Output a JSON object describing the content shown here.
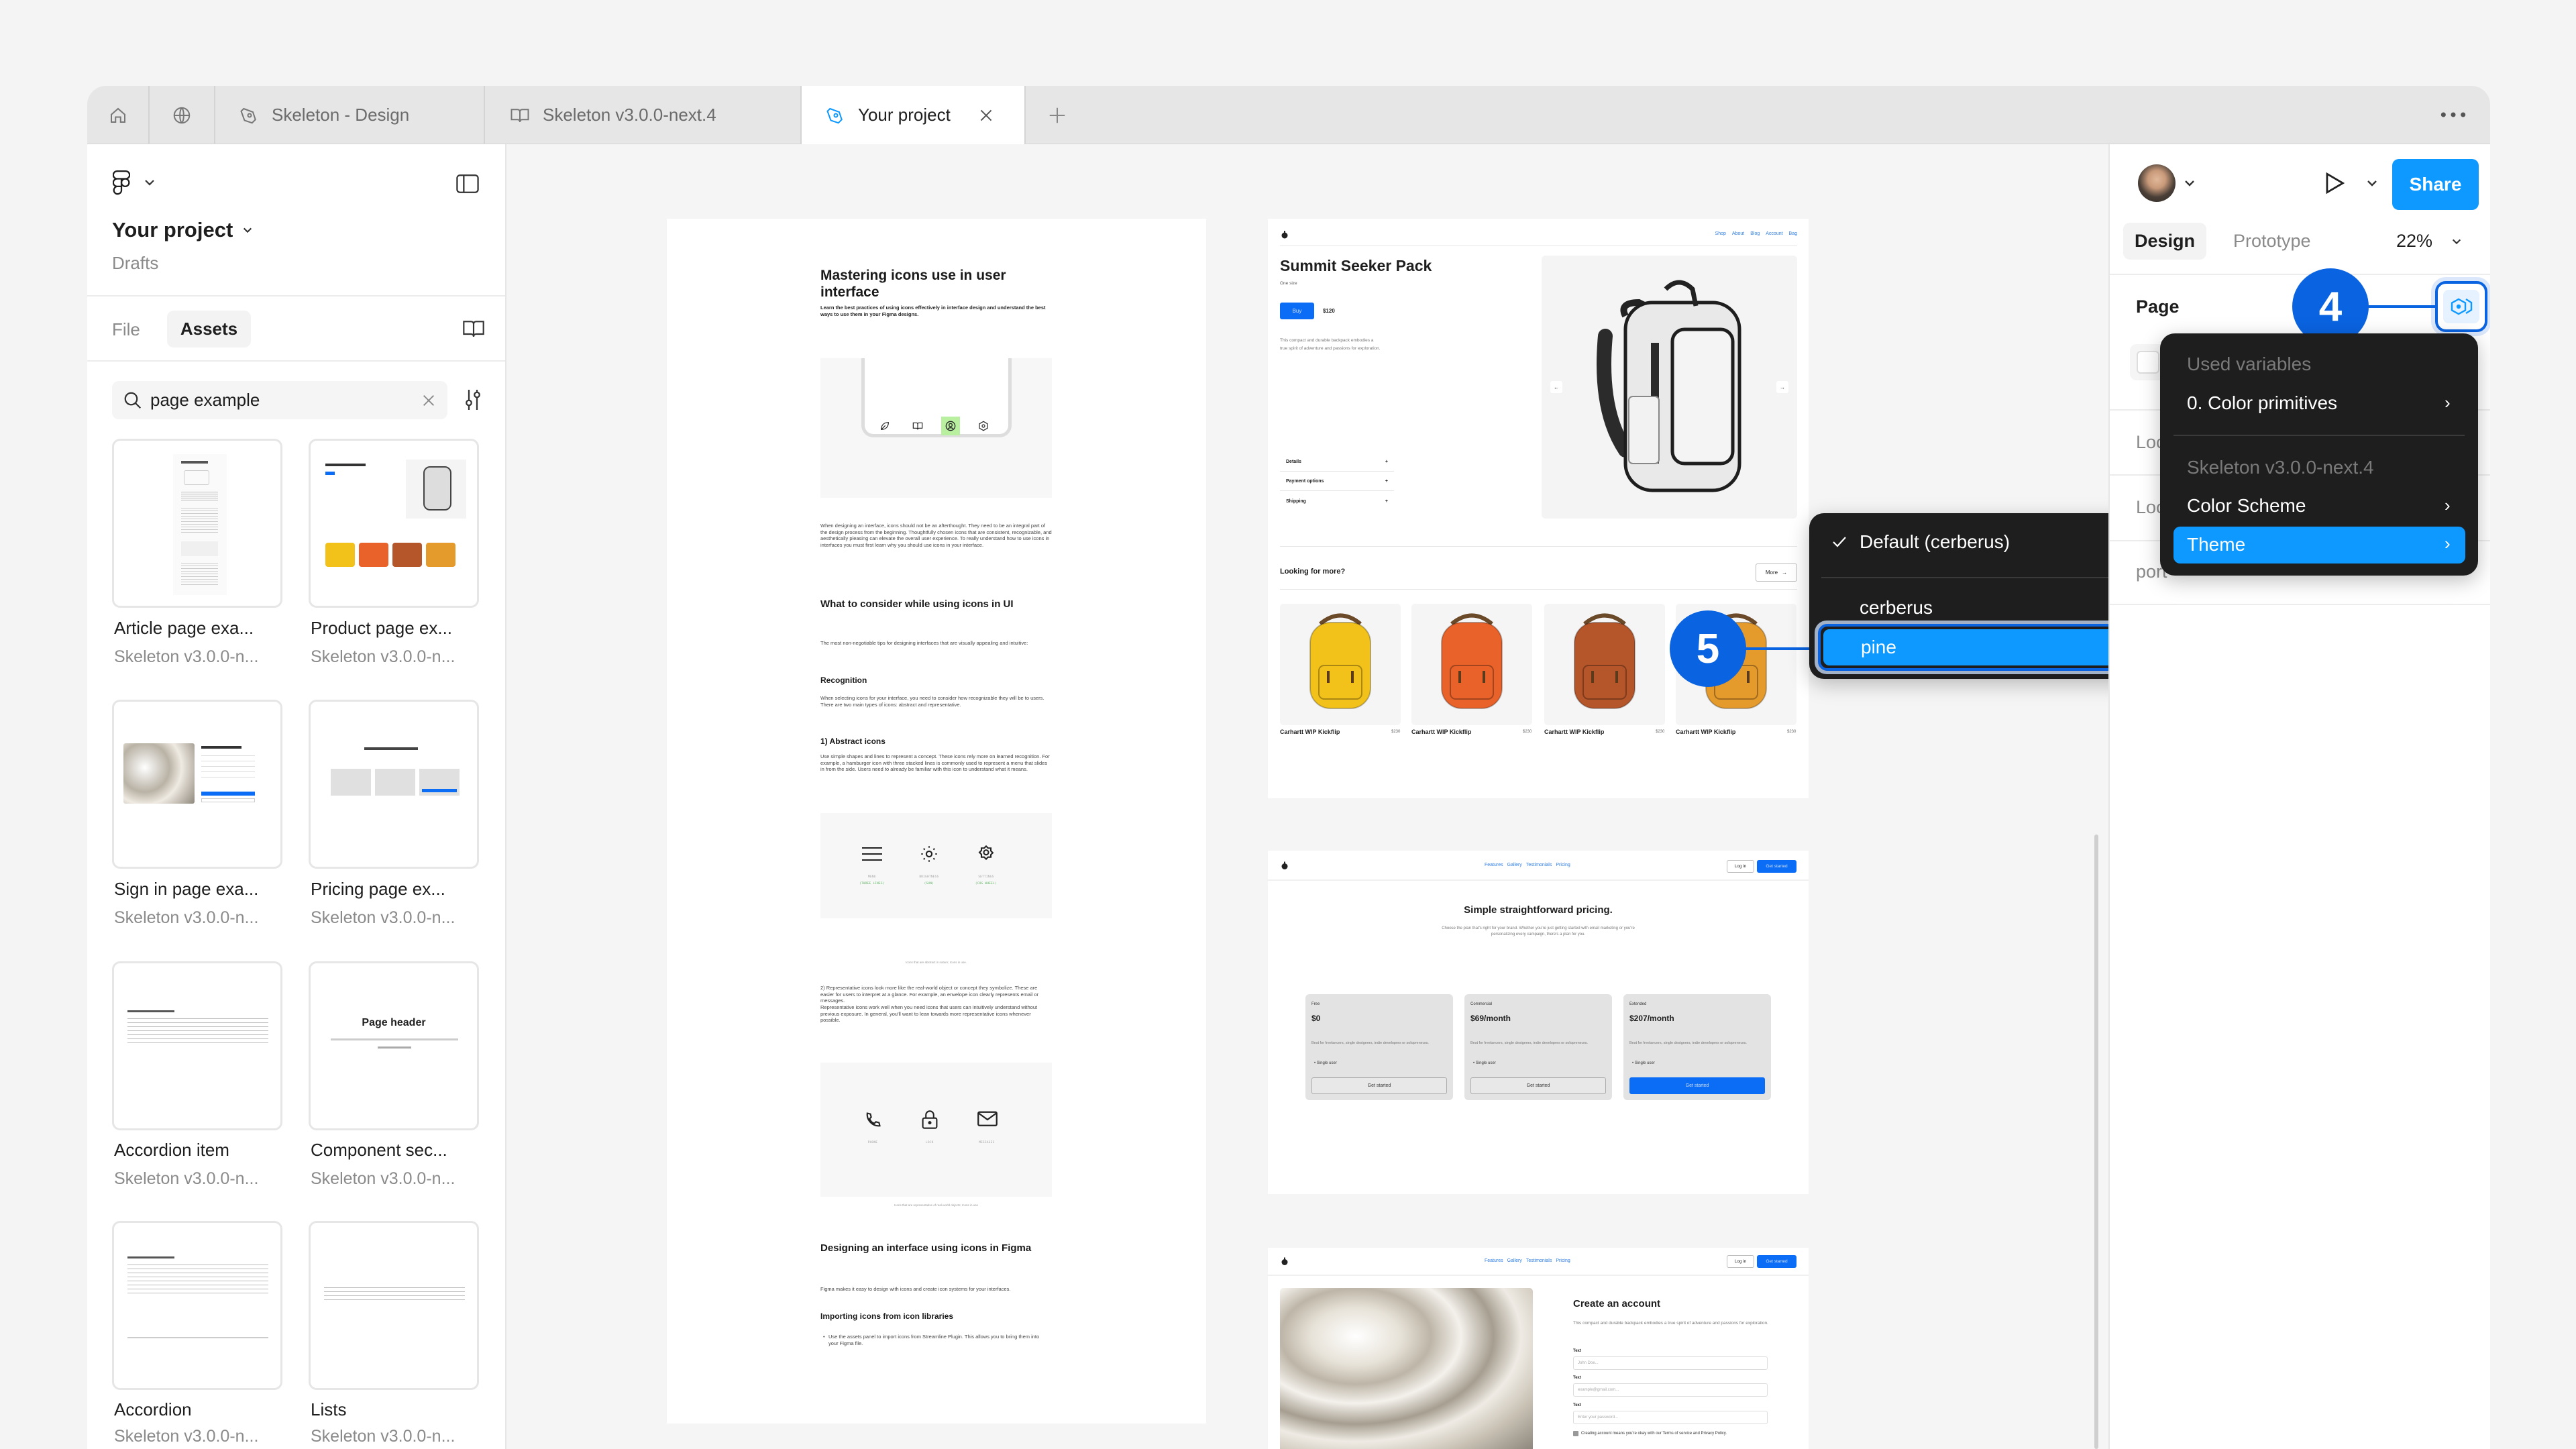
{
  "tabs": [
    {
      "icon": "home-icon"
    },
    {
      "icon": "globe-icon"
    },
    {
      "label": "Skeleton - Design",
      "icon": "pen-icon"
    },
    {
      "label": "Skeleton v3.0.0-next.4",
      "icon": "book-icon"
    },
    {
      "label": "Your project",
      "icon": "pen-icon",
      "active": true
    }
  ],
  "sidebar": {
    "project_name": "Your project",
    "location": "Drafts",
    "tab_file": "File",
    "tab_assets": "Assets",
    "search_value": "page example",
    "assets": [
      {
        "label": "Article page exa...",
        "source": "Skeleton v3.0.0-n..."
      },
      {
        "label": "Product page ex...",
        "source": "Skeleton v3.0.0-n..."
      },
      {
        "label": "Sign in page exa...",
        "source": "Skeleton v3.0.0-n..."
      },
      {
        "label": "Pricing page ex...",
        "source": "Skeleton v3.0.0-n..."
      },
      {
        "label": "Accordion item",
        "source": "Skeleton v3.0.0-n..."
      },
      {
        "label": "Component sec...",
        "source": "Skeleton v3.0.0-n...",
        "thumb_text": "Page header"
      },
      {
        "label": "Accordion",
        "source": "Skeleton v3.0.0-n..."
      },
      {
        "label": "Lists",
        "source": "Skeleton v3.0.0-n..."
      }
    ]
  },
  "right_panel": {
    "share": "Share",
    "tab_design": "Design",
    "tab_prototype": "Prototype",
    "zoom": "22%",
    "section_page": "Page",
    "row_loc1": "Loc",
    "row_loc2": "Loc",
    "row_export": "port"
  },
  "variables_menu": {
    "header1": "Used variables",
    "item1": "0. Color primitives",
    "header2": "Skeleton v3.0.0-next.4",
    "item2": "Color Scheme",
    "item3": "Theme"
  },
  "theme_menu": {
    "default": "Default (cerberus)",
    "options": [
      "cerberus",
      "pine"
    ],
    "selected": "pine"
  },
  "annotations": {
    "step4": "4",
    "step5": "5"
  },
  "colors": {
    "accent": "#0d99ff",
    "badge": "#0a63e0",
    "frame_blue": "#0b6cf5",
    "menu_bg": "#1e1e1e"
  },
  "article": {
    "title": "Mastering icons use in user interface",
    "subtitle": "Learn the best practices of using icons effectively in interface design and understand the best ways to use them in your Figma designs.",
    "p1": "When designing an interface, icons should not be an afterthought. They need to be an integral part of the design process from the beginning. Thoughtfully chosen icons that are consistent, recognizable, and aesthetically pleasing can elevate the overall user experience. To really understand how to use icons in interfaces you must first learn why you should use icons in your interface.",
    "h2": "What to consider while using icons in UI",
    "p2": "The most non-negotiable tips for designing interfaces that are visually appealing and intuitive:",
    "h3": "Recognition",
    "p3": "When selecting icons for your interface, you need to consider how recognizable they will be to users. There are two main types of icons: abstract and representative.",
    "h4": "1) Abstract icons",
    "p4": "Use simple shapes and lines to represent a concept. These icons rely more on learned recognition. For example, a hamburger icon with three stacked lines is commonly used to represent a menu that slides in from the side. Users need to already be familiar with this icon to understand what it means.",
    "abstract_icons": [
      {
        "name": "MENU",
        "desc": "(THREE LINES)"
      },
      {
        "name": "BRIGHTNESS",
        "desc": "(SUN)"
      },
      {
        "name": "SETTINGS",
        "desc": "(COG WHEEL)"
      }
    ],
    "caption1": "Icons that are abstract in nature; Icons in use.",
    "p5a": "2) Representative icons look more like the real-world object or concept they symbolize. These are easier for users to interpret at a glance. For example, an envelope icon clearly represents email or messages.",
    "p5b": "Representative icons work well when you need icons that users can intuitively understand without previous exposure. In general, you'll want to lean towards more representative icons whenever possible.",
    "repr_icons": [
      "PHONE",
      "LOCK",
      "MESSAGES"
    ],
    "caption2": "Icons that are representative of real-world objects; Icons in use",
    "h5": "Designing an interface using icons in Figma",
    "p6": "Figma makes it easy to design with icons and create icon systems for your interfaces.",
    "h6": "Importing icons from icon libraries",
    "bullet": "Use the assets panel to import icons from Streamline Plugin. This allows you to bring them into your Figma file."
  },
  "product": {
    "nav": [
      "Shop",
      "About",
      "Blog",
      "Account",
      "Bag"
    ],
    "title": "Summit Seeker Pack",
    "size": "One size",
    "buy": "Buy",
    "price": "$120",
    "description": "This compact and durable backpack embodies a true spirit of adventure and passions for exploration.",
    "accordion": [
      "Details",
      "Payment options",
      "Shipping"
    ],
    "more_heading": "Looking for more?",
    "more_button": "More",
    "items": [
      {
        "name": "Carhartt WIP Kickflip",
        "price": "$230",
        "color": "#f2c21b"
      },
      {
        "name": "Carhartt WIP Kickflip",
        "price": "$230",
        "color": "#e8622a"
      },
      {
        "name": "Carhartt WIP Kickflip",
        "price": "$230",
        "color": "#b5552a"
      },
      {
        "name": "Carhartt WIP Kickflip",
        "price": "$230",
        "color": "#e59a2c"
      }
    ]
  },
  "site_nav": {
    "links": [
      "Features",
      "Gallery",
      "Testimonials",
      "Pricing"
    ],
    "login": "Log in",
    "get_started": "Get started"
  },
  "pricing": {
    "title": "Simple straightforward pricing.",
    "description": "Choose the plan that's right for your brand. Whether you're just getting started with email marketing or you're personalizing every campaign, there's a plan for you.",
    "plans": [
      {
        "name": "Free",
        "price": "$0",
        "desc": "Best for freelancers, single designers, indie developers or solopreneurs.",
        "feature": "Single user",
        "cta": "Get started",
        "primary": false
      },
      {
        "name": "Commercial",
        "price": "$69/month",
        "desc": "Best for freelancers, single designers, indie developers or solopreneurs.",
        "feature": "Single user",
        "cta": "Get started",
        "primary": false
      },
      {
        "name": "Extended",
        "price": "$207/month",
        "desc": "Best for freelancers, single designers, indie developers or solopreneurs.",
        "feature": "Single user",
        "cta": "Get started",
        "primary": true
      }
    ]
  },
  "signin": {
    "title": "Create an account",
    "description": "This compact and durable backpack embodies a true spirit of adventure and passions for exploration.",
    "fields": [
      {
        "label": "Text",
        "placeholder": "John Doe..."
      },
      {
        "label": "Text",
        "placeholder": "example@gmail.com..."
      },
      {
        "label": "Text",
        "placeholder": "Enter your password..."
      }
    ],
    "terms": "Creating account means you're okay with our Terms of service and Privacy Policy."
  }
}
